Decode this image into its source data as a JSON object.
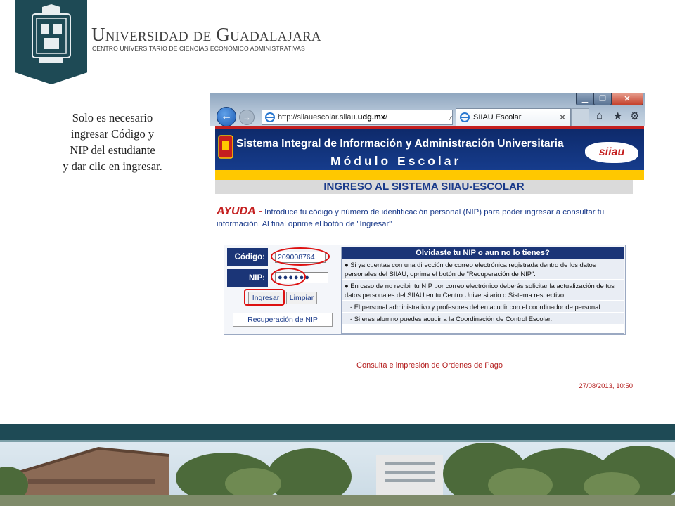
{
  "header": {
    "university_name": "Universidad de Guadalajara",
    "university_center": "CENTRO UNIVERSITARIO DE CIENCIAS ECONÓMICO ADMINISTRATIVAS",
    "brand_color": "#1e4a55"
  },
  "instructions": {
    "line1": "Solo es necesario",
    "line2": "ingresar Código y",
    "line3": "NIP del estudiante",
    "line4": "y dar clic en ingresar."
  },
  "browser": {
    "url_prefix": "http://siiauescolar.siiau.",
    "url_domain": "udg.mx",
    "url_suffix": "/",
    "address_controls": "⌕ ▾ ↻ ✕",
    "tab_title": "SIIAU Escolar",
    "tab_close": "✕",
    "window_min": "▁",
    "window_max": "❐",
    "window_close": "✕",
    "back_glyph": "←",
    "forward_glyph": "→",
    "home_glyph": "⌂",
    "favorites_glyph": "★",
    "tools_glyph": "⚙"
  },
  "siiau": {
    "title_line1": "Sistema Integral de Información y Administración Universitaria",
    "title_line2": "Módulo Escolar",
    "logo_text_a": "sii",
    "logo_text_b": "au",
    "section_title": "INGRESO AL SISTEMA SIIAU-ESCOLAR",
    "help_label": "AYUDA -",
    "help_text": "Introduce tu código y número de identificación personal (NIP) para poder ingresar a consultar tu información. Al final oprime el botón de \"Ingresar\"",
    "codigo_label": "Código:",
    "codigo_value": "209008764",
    "nip_label": "NIP:",
    "nip_value": "●●●●●●",
    "ingresar_button": "Ingresar",
    "limpiar_button": "Limpiar",
    "recuperacion_button": "Recuperación de NIP",
    "forgot_title": "Olvidaste tu NIP o aun no lo tienes?",
    "forgot_rows": [
      "●  Si ya cuentas con una dirección de correo electrónica registrada dentro de los datos personales del SIIAU, oprime el botón de \"Recuperación de NIP\".",
      "●  En caso de no recibir tu NIP por correo electrónico deberás solicitar la actualización de tus datos personales del SIIAU en tu Centro Universitario o Sistema respectivo.",
      "- El personal administrativo y profesores deben acudir con el coordinador de personal.",
      "- Si eres alumno puedes acudir a la Coordinación de Control Escolar."
    ],
    "consulta_link": "Consulta e impresión de Ordenes de Pago",
    "datetime": "27/08/2013, 10:50"
  }
}
